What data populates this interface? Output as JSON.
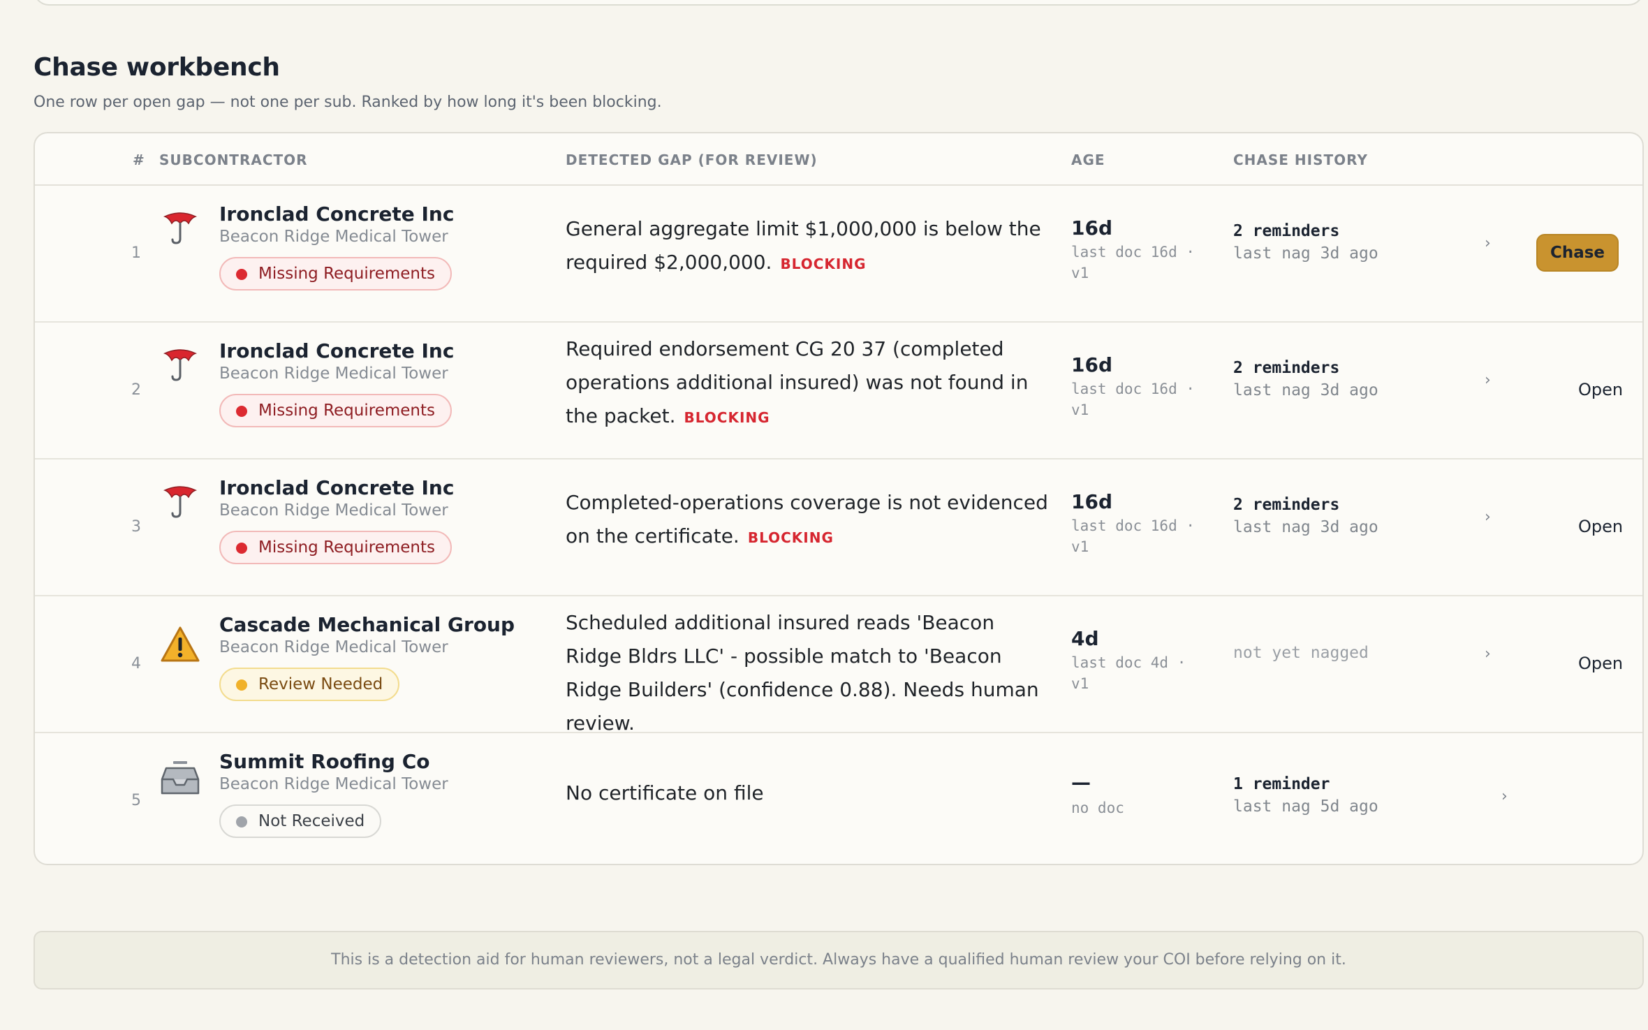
{
  "section": {
    "title": "Chase workbench",
    "subtitle": "One row per open gap — not one per sub. Ranked by how long it's been blocking."
  },
  "table": {
    "headers": {
      "num": "#",
      "subcontractor": "SUBCONTRACTOR",
      "gap": "DETECTED GAP (FOR REVIEW)",
      "age": "AGE",
      "history": "CHASE HISTORY"
    },
    "rows": [
      {
        "num": "1",
        "icon": "umbrella-icon",
        "name": "Ironclad Concrete Inc",
        "project": "Beacon Ridge Medical Tower",
        "status": "Missing Requirements",
        "gap": "General aggregate limit $1,000,000 is below the required $2,000,000.",
        "flag": "BLOCKING",
        "age": "16d",
        "age_sub": "last doc 16d · v1",
        "history": "2 reminders",
        "history_sub": "last nag 3d ago",
        "chevron": "›",
        "action": "Chase"
      },
      {
        "num": "2",
        "icon": "umbrella-icon",
        "name": "Ironclad Concrete Inc",
        "project": "Beacon Ridge Medical Tower",
        "status": "Missing Requirements",
        "gap": "Required endorsement CG 20 37 (completed operations additional insured) was not found in the packet.",
        "flag": "BLOCKING",
        "age": "16d",
        "age_sub": "last doc 16d · v1",
        "history": "2 reminders",
        "history_sub": "last nag 3d ago",
        "chevron": "›",
        "action": "Open"
      },
      {
        "num": "3",
        "icon": "umbrella-icon",
        "name": "Ironclad Concrete Inc",
        "project": "Beacon Ridge Medical Tower",
        "status": "Missing Requirements",
        "gap": "Completed-operations coverage is not evidenced on the certificate.",
        "flag": "BLOCKING",
        "age": "16d",
        "age_sub": "last doc 16d · v1",
        "history": "2 reminders",
        "history_sub": "last nag 3d ago",
        "chevron": "›",
        "action": "Open"
      },
      {
        "num": "4",
        "icon": "warning-icon",
        "name": "Cascade Mechanical Group",
        "project": "Beacon Ridge Medical Tower",
        "status": "Review Needed",
        "gap": "Scheduled additional insured reads 'Beacon Ridge Bldrs LLC' - possible match to 'Beacon Ridge Builders' (confidence 0.88). Needs human review.",
        "flag": "",
        "age": "4d",
        "age_sub": "last doc 4d · v1",
        "history": "",
        "history_sub": "not yet nagged",
        "chevron": "›",
        "action": "Open"
      },
      {
        "num": "5",
        "icon": "inbox-icon",
        "name": "Summit Roofing Co",
        "project": "Beacon Ridge Medical Tower",
        "status": "Not Received",
        "gap": "No certificate on file",
        "flag": "",
        "age": "—",
        "age_sub": "no doc",
        "history": "1 reminder",
        "history_sub": "last nag 5d ago",
        "chevron": "›",
        "action": ""
      }
    ]
  },
  "footer": {
    "disclaimer": "This is a detection aid for human reviewers, not a legal verdict. Always have a qualified human review your COI before relying on it."
  },
  "colors": {
    "background": "#f7f5ee",
    "accent_button": "#c9932f",
    "blocking": "#d62630",
    "missing_pill": "#dc2a31",
    "review_pill": "#f0b12a",
    "not_received_pill": "#a0a4aa"
  }
}
